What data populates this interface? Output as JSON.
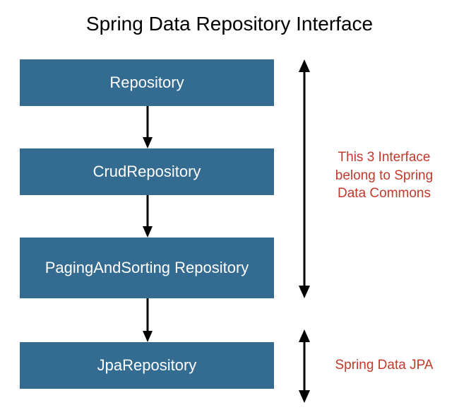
{
  "title": "Spring Data Repository Interface",
  "boxes": {
    "repository": "Repository",
    "crud_repository": "CrudRepository",
    "paging_sorting_repository": "PagingAndSorting Repository",
    "jpa_repository": "JpaRepository"
  },
  "annotations": {
    "commons": "This 3 Interface belong to Spring Data Commons",
    "jpa": "Spring Data JPA"
  },
  "colors": {
    "box_bg": "#336b91",
    "box_text": "#ffffff",
    "annotation_text": "#c0392b",
    "arrow": "#000000"
  }
}
